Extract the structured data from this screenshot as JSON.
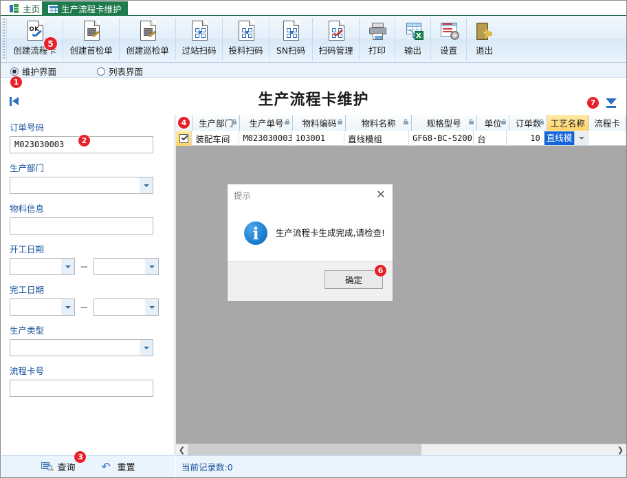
{
  "window": {
    "tabs": [
      {
        "label": "主页",
        "icon": "home-icon",
        "active": false
      },
      {
        "label": "生产流程卡维护",
        "icon": "grid-icon",
        "active": true
      }
    ]
  },
  "ribbon": {
    "buttons": [
      {
        "label": "创建流程卡",
        "icon": "doc-ok-check-icon"
      },
      {
        "label": "创建首检单",
        "icon": "doc-lines-pencil-icon"
      },
      {
        "label": "创建巡检单",
        "icon": "doc-lines-pencil-icon"
      },
      {
        "label": "过站扫码",
        "icon": "doc-qrcode-icon"
      },
      {
        "label": "投料扫码",
        "icon": "doc-qrcode-icon"
      },
      {
        "label": "SN扫码",
        "icon": "doc-qrcode-icon"
      },
      {
        "label": "扫码管理",
        "icon": "doc-qrcode-check-icon"
      },
      {
        "label": "打印",
        "icon": "printer-icon"
      },
      {
        "label": "输出",
        "icon": "export-excel-icon"
      },
      {
        "label": "设置",
        "icon": "settings-gear-icon"
      },
      {
        "label": "退出",
        "icon": "exit-door-icon"
      }
    ]
  },
  "viewbar": {
    "options": [
      {
        "label": "维护界面",
        "selected": true
      },
      {
        "label": "列表界面",
        "selected": false
      }
    ]
  },
  "header": {
    "title": "生产流程卡维护",
    "first_page_icon": "first-page-icon",
    "download_icon": "download-icon"
  },
  "filters": {
    "fields": [
      {
        "label": "订单号码",
        "type": "text",
        "value": "M023030003",
        "placeholder": ""
      },
      {
        "label": "生产部门",
        "type": "combo",
        "value": "",
        "placeholder": ""
      },
      {
        "label": "物料信息",
        "type": "text",
        "value": "",
        "placeholder": ""
      },
      {
        "label": "开工日期",
        "type": "daterange",
        "value_from": "",
        "value_to": "",
        "separator": "－"
      },
      {
        "label": "完工日期",
        "type": "daterange",
        "value_from": "",
        "value_to": "",
        "separator": "－"
      },
      {
        "label": "生产类型",
        "type": "combo",
        "value": "",
        "placeholder": ""
      },
      {
        "label": "流程卡号",
        "type": "text",
        "value": "",
        "placeholder": ""
      }
    ],
    "actions": [
      {
        "label": "查询",
        "icon": "search-icon"
      },
      {
        "label": "重置",
        "icon": "reset-icon"
      }
    ]
  },
  "grid": {
    "columns": [
      {
        "label": "",
        "width": 26,
        "locked": false,
        "selected": false
      },
      {
        "label": "生产部门",
        "width": 76,
        "locked": true,
        "selected": false
      },
      {
        "label": "生产单号",
        "width": 84,
        "locked": true,
        "selected": false
      },
      {
        "label": "物料编码",
        "width": 84,
        "locked": true,
        "selected": false
      },
      {
        "label": "物料名称",
        "width": 104,
        "locked": true,
        "selected": false
      },
      {
        "label": "规格型号",
        "width": 104,
        "locked": true,
        "selected": false
      },
      {
        "label": "单位",
        "width": 52,
        "locked": true,
        "selected": false
      },
      {
        "label": "订单数",
        "width": 60,
        "locked": true,
        "selected": false
      },
      {
        "label": "工艺名称",
        "width": 65,
        "locked": false,
        "selected": true
      },
      {
        "label": "流程卡",
        "width": 60,
        "locked": false,
        "selected": false
      }
    ],
    "rows": [
      {
        "checked": true,
        "生产部门": "装配车间",
        "生产单号": "M023030003",
        "物料编码": "103001",
        "物料名称": "直线模组",
        "规格型号": "GF68-BC-S200",
        "单位": "台",
        "订单数": "10",
        "工艺名称": "直线模",
        "流程卡": ""
      }
    ]
  },
  "statusbar": {
    "text": "当前记录数:0"
  },
  "dialog": {
    "title": "提示",
    "message": "生产流程卡生成完成,请检查!",
    "icon": "info-icon",
    "close_icon": "close-icon",
    "ok_label": "确定"
  },
  "annotations": [
    {
      "num": "1"
    },
    {
      "num": "2"
    },
    {
      "num": "3"
    },
    {
      "num": "4"
    },
    {
      "num": "5"
    },
    {
      "num": "6"
    },
    {
      "num": "7"
    }
  ],
  "colors": {
    "tab_active_bg": "#1f7a4d",
    "badge_red": "#e8202a",
    "label_blue": "#17509b",
    "selected_col": "#ffd469",
    "edit_cell_blue": "#1565d8",
    "grid_bg": "#a8a8a8"
  }
}
